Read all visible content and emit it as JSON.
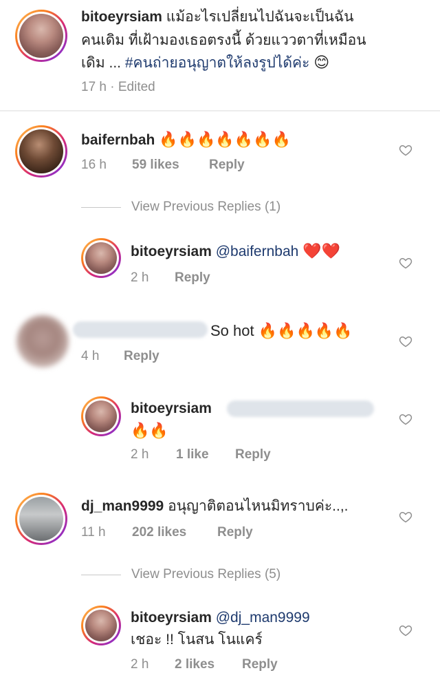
{
  "caption": {
    "username": "bitoeyrsiam",
    "line1": "แม้อะไรเปลี่ยนไปฉันจะเป็นฉัน",
    "line2": "คนเดิม ที่เฝ้ามองเธอตรงนี้ ด้วยแววตาที่เหมือน",
    "line3_text": "เดิม ... ",
    "hashtag": "#คนถ่ายอนุญาตให้ลงรูปได้ค่ะ",
    "emoji": "😊",
    "meta": "17 h · Edited"
  },
  "comments": [
    {
      "username": "baifernbah",
      "text": "🔥🔥🔥🔥🔥🔥🔥",
      "time": "16 h",
      "likes": "59 likes",
      "reply": "Reply",
      "view_replies": "View Previous Replies (1)"
    },
    {
      "username": "bitoeyrsiam",
      "mention": "@baifernbah",
      "text": "❤️❤️",
      "time": "2 h",
      "reply": "Reply"
    },
    {
      "username": "",
      "text": "So hot 🔥🔥🔥🔥🔥",
      "time": "4 h",
      "reply": "Reply"
    },
    {
      "username": "bitoeyrsiam",
      "text": "🔥🔥",
      "time": "2 h",
      "likes": "1 like",
      "reply": "Reply"
    },
    {
      "username": "dj_man9999",
      "text": "อนุญาติตอนไหนมิทราบค่ะ..,.",
      "time": "11 h",
      "likes": "202 likes",
      "reply": "Reply",
      "view_replies": "View Previous Replies (5)"
    },
    {
      "username": "bitoeyrsiam",
      "mention": "@dj_man9999",
      "text": "เชอะ !! โนสน โนแคร์",
      "time": "2 h",
      "likes": "2 likes",
      "reply": "Reply"
    }
  ],
  "icons": {
    "like": "heart-outline-icon",
    "fire": "fire-emoji",
    "heart": "red-heart-emoji"
  },
  "colors": {
    "text": "#262626",
    "meta": "#8e8e8e",
    "mention": "#1e3a6e",
    "ring_gradient": [
      "#fdc468",
      "#fa7e1e",
      "#d62976",
      "#962fbf"
    ]
  }
}
